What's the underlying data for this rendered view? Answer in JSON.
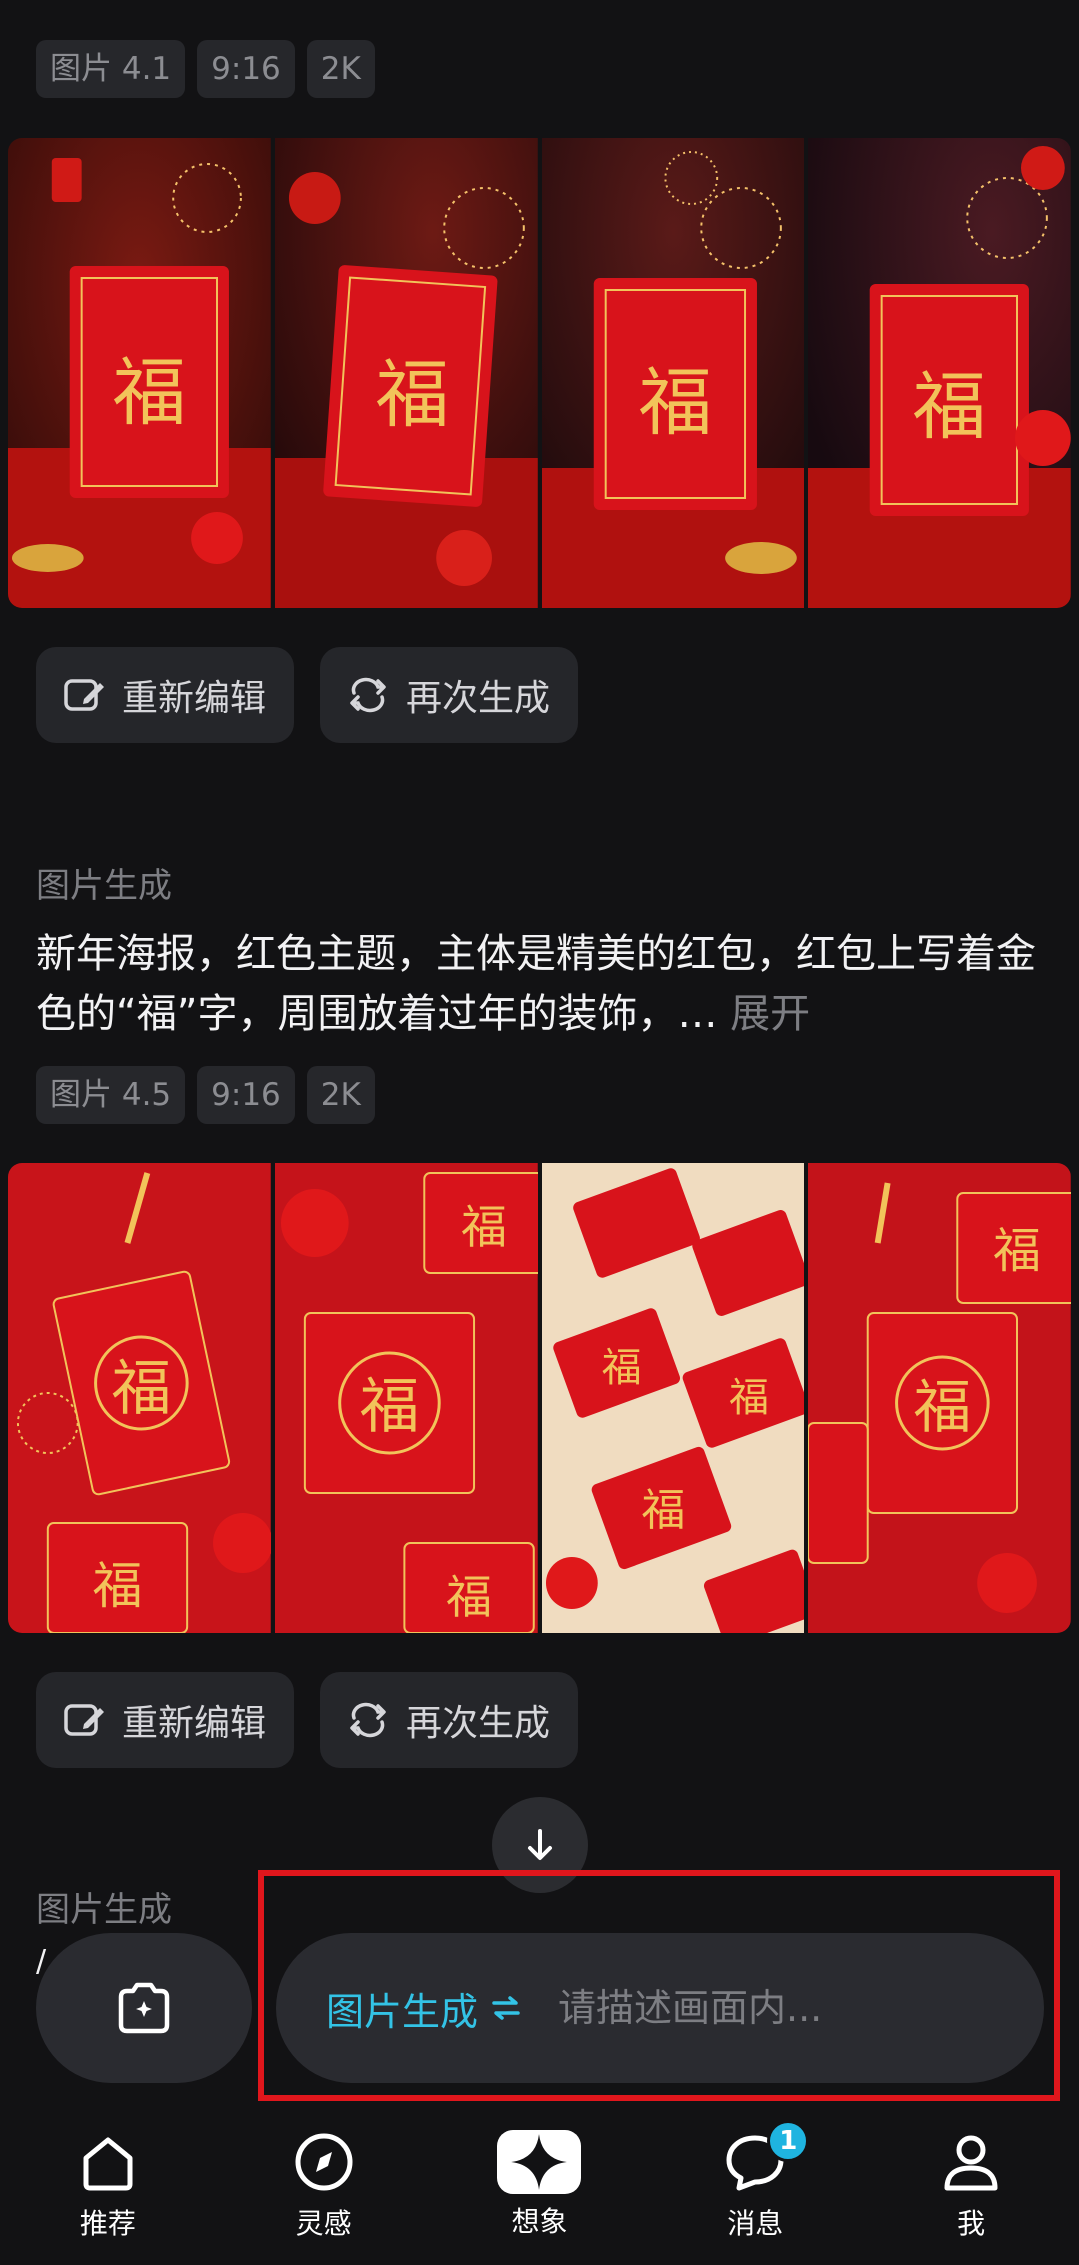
{
  "first_result": {
    "tags": [
      "图片 4.1",
      "9:16",
      "2K"
    ],
    "edit_label": "重新编辑",
    "regen_label": "再次生成"
  },
  "second_result": {
    "section_label": "图片生成",
    "prompt": "新年海报，红色主题，主体是精美的红包，红包上写着金色的“福”字，周围放着过年的装饰，…",
    "expand_label": "展开",
    "tags": [
      "图片 4.5",
      "9:16",
      "2K"
    ],
    "edit_label": "重新编辑",
    "regen_label": "再次生成"
  },
  "third_result": {
    "section_label": "图片生成",
    "prompt_partial": "/"
  },
  "gallery_glyph": "福",
  "composer": {
    "mode_label": "图片生成",
    "mode_switch_icon": "swap-icon",
    "placeholder": "请描述画面内..."
  },
  "tabbar": {
    "items": [
      {
        "label": "推荐",
        "icon": "home-icon"
      },
      {
        "label": "灵感",
        "icon": "compass-icon"
      },
      {
        "label": "想象",
        "icon": "sparkle-icon"
      },
      {
        "label": "消息",
        "icon": "chat-icon",
        "badge": "1"
      },
      {
        "label": "我",
        "icon": "profile-icon"
      }
    ]
  },
  "colors": {
    "background": "#121214",
    "accent": "#33c3e6",
    "highlight": "#e0161c",
    "envelope_red": "#d8131b",
    "gold": "#f2c35a"
  }
}
